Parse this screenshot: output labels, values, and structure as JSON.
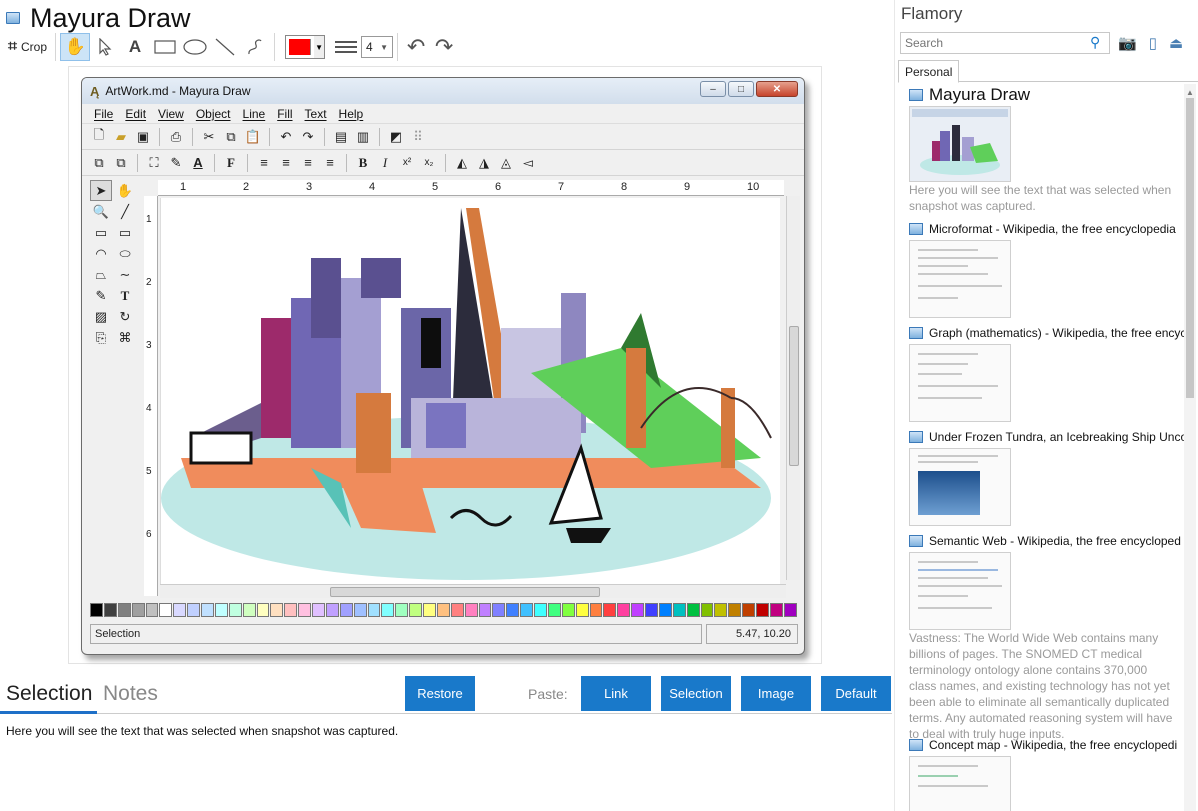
{
  "app": {
    "title": "Mayura Draw"
  },
  "toolbar": {
    "crop_label": "Crop",
    "color_value": "#ff0000",
    "line_width": "4"
  },
  "screenshot": {
    "window_title": "ArtWork.md - Mayura Draw",
    "menu": [
      "File",
      "Edit",
      "View",
      "Object",
      "Line",
      "Fill",
      "Text",
      "Help"
    ],
    "ruler_ticks": [
      "1",
      "2",
      "3",
      "4",
      "5",
      "6",
      "7",
      "8",
      "9",
      "10"
    ],
    "ruler_left_ticks": [
      "1",
      "2",
      "3",
      "4",
      "5",
      "6"
    ],
    "status_left": "Selection",
    "status_right": "5.47, 10.20",
    "palette": [
      "#000000",
      "#404040",
      "#808080",
      "#a0a0a0",
      "#c0c0c0",
      "#ffffff",
      "#d9d9ff",
      "#c0d0ff",
      "#c0e0ff",
      "#c0ffff",
      "#c0ffe0",
      "#d0ffc0",
      "#ffffc0",
      "#ffe0c0",
      "#ffc0c0",
      "#ffc0e0",
      "#e0c0ff",
      "#c0a0ff",
      "#a0a0ff",
      "#a0c0ff",
      "#a0e0ff",
      "#80ffff",
      "#a0ffc0",
      "#c0ff80",
      "#ffff80",
      "#ffc080",
      "#ff8080",
      "#ff80c0",
      "#c080ff",
      "#8080ff",
      "#4080ff",
      "#40c0ff",
      "#40ffff",
      "#40ff80",
      "#80ff40",
      "#ffff40",
      "#ff8040",
      "#ff4040",
      "#ff40a0",
      "#c040ff",
      "#4040ff",
      "#0080ff",
      "#00c0c0",
      "#00c040",
      "#80c000",
      "#c0c000",
      "#c08000",
      "#c04000",
      "#c00000",
      "#c00080",
      "#a000c0"
    ]
  },
  "bottom": {
    "tab_selection": "Selection",
    "tab_notes": "Notes",
    "restore_label": "Restore",
    "paste_label": "Paste:",
    "paste_link": "Link",
    "paste_selection": "Selection",
    "paste_image": "Image",
    "paste_default": "Default",
    "selection_text": "Here you will see the text that was selected when snapshot was captured."
  },
  "sidebar": {
    "title": "Flamory",
    "search_placeholder": "Search",
    "tab_personal": "Personal",
    "items": [
      {
        "title": "Mayura Draw",
        "desc": "Here you will see the text that was selected when snapshot was captured."
      },
      {
        "title": "Microformat - Wikipedia, the free encyclopedia",
        "desc": ""
      },
      {
        "title": "Graph (mathematics) - Wikipedia, the free encyc",
        "desc": ""
      },
      {
        "title": "Under Frozen Tundra, an Icebreaking Ship Unco",
        "desc": ""
      },
      {
        "title": "Semantic Web - Wikipedia, the free encycloped",
        "desc": "Vastness: The World Wide Web contains many billions of pages. The SNOMED CT medical terminology ontology alone contains 370,000 class names, and existing technology has not yet been able to eliminate all semantically duplicated terms. Any automated reasoning system will have to deal with truly huge inputs."
      },
      {
        "title": "Concept map - Wikipedia, the free encyclopedi",
        "desc": ""
      }
    ]
  },
  "colors": {
    "accent": "#1979ca",
    "tab_underline": "#1e70c8"
  }
}
